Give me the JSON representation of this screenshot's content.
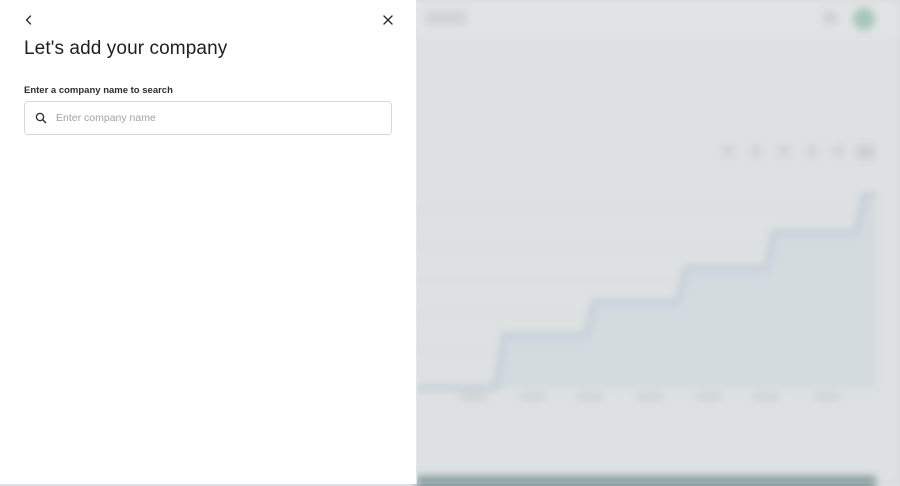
{
  "panel": {
    "title": "Let's add your company",
    "field_label": "Enter a company name to search",
    "search": {
      "placeholder": "Enter company name",
      "value": ""
    },
    "icons": {
      "back": "chevron-left-icon",
      "close": "close-icon",
      "search": "search-icon"
    }
  },
  "colors": {
    "panel_bg": "#ffffff",
    "backdrop": "#e4e6e7",
    "title_text": "#1c1f21",
    "input_border": "#d5d8da",
    "placeholder": "#9ea3a6",
    "avatar": "#8fbfa7"
  }
}
